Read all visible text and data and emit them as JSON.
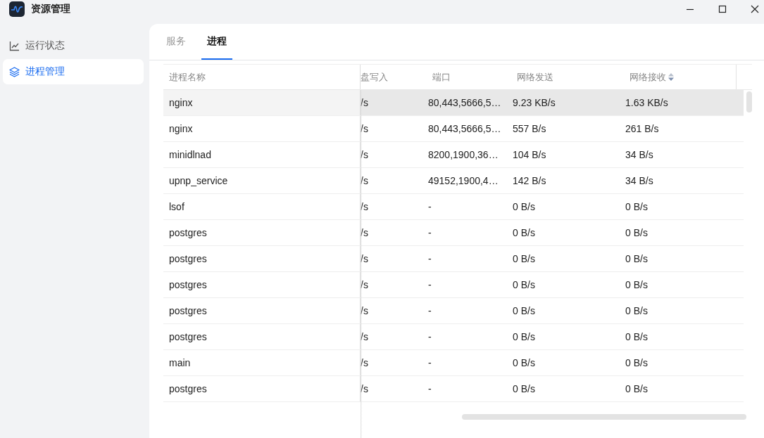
{
  "window": {
    "title": "资源管理"
  },
  "sidebar": {
    "items": [
      {
        "label": "运行状态",
        "kind": "chart",
        "selected": false
      },
      {
        "label": "进程管理",
        "kind": "layers",
        "selected": true
      }
    ]
  },
  "tabs": [
    {
      "label": "服务",
      "selected": false
    },
    {
      "label": "进程",
      "selected": true
    }
  ],
  "table": {
    "columns": [
      {
        "label": "进程名称",
        "sortable": false
      },
      {
        "label": "盘写入",
        "sortable": false
      },
      {
        "label": "端口",
        "sortable": false
      },
      {
        "label": "网络发送",
        "sortable": false
      },
      {
        "label": "网络接收",
        "sortable": true
      }
    ],
    "rows": [
      {
        "selected": true,
        "cells": [
          "nginx",
          "/s",
          "80,443,5666,5…",
          "9.23 KB/s",
          "1.63 KB/s"
        ]
      },
      {
        "selected": false,
        "cells": [
          "nginx",
          "/s",
          "80,443,5666,5…",
          "557 B/s",
          "261 B/s"
        ]
      },
      {
        "selected": false,
        "cells": [
          "minidlnad",
          "/s",
          "8200,1900,36…",
          "104 B/s",
          "34 B/s"
        ]
      },
      {
        "selected": false,
        "cells": [
          "upnp_service",
          "/s",
          "49152,1900,4…",
          "142 B/s",
          "34 B/s"
        ]
      },
      {
        "selected": false,
        "cells": [
          "lsof",
          "/s",
          "-",
          "0 B/s",
          "0 B/s"
        ]
      },
      {
        "selected": false,
        "cells": [
          "postgres",
          "/s",
          "-",
          "0 B/s",
          "0 B/s"
        ]
      },
      {
        "selected": false,
        "cells": [
          "postgres",
          "/s",
          "-",
          "0 B/s",
          "0 B/s"
        ]
      },
      {
        "selected": false,
        "cells": [
          "postgres",
          "/s",
          "-",
          "0 B/s",
          "0 B/s"
        ]
      },
      {
        "selected": false,
        "cells": [
          "postgres",
          "/s",
          "-",
          "0 B/s",
          "0 B/s"
        ]
      },
      {
        "selected": false,
        "cells": [
          "postgres",
          "/s",
          "-",
          "0 B/s",
          "0 B/s"
        ]
      },
      {
        "selected": false,
        "cells": [
          "main",
          "/s",
          "-",
          "0 B/s",
          "0 B/s"
        ]
      },
      {
        "selected": false,
        "cells": [
          "postgres",
          "/s",
          "-",
          "0 B/s",
          "0 B/s"
        ]
      }
    ]
  }
}
